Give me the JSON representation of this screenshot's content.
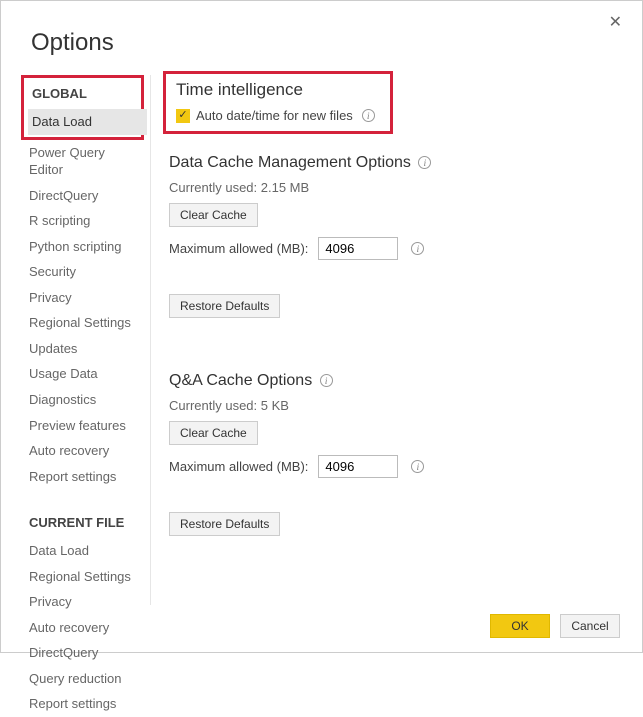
{
  "dialog": {
    "title": "Options",
    "close_glyph": "✕"
  },
  "sidebar": {
    "global_header": "GLOBAL",
    "global_items": [
      "Data Load",
      "Power Query Editor",
      "DirectQuery",
      "R scripting",
      "Python scripting",
      "Security",
      "Privacy",
      "Regional Settings",
      "Updates",
      "Usage Data",
      "Diagnostics",
      "Preview features",
      "Auto recovery",
      "Report settings"
    ],
    "current_file_header": "CURRENT FILE",
    "current_file_items": [
      "Data Load",
      "Regional Settings",
      "Privacy",
      "Auto recovery",
      "DirectQuery",
      "Query reduction",
      "Report settings"
    ],
    "selected_global_index": 0
  },
  "content": {
    "time_intelligence": {
      "title": "Time intelligence",
      "checkbox_label": "Auto date/time for new files",
      "checked": true
    },
    "data_cache": {
      "title": "Data Cache Management Options",
      "currently_used_label": "Currently used: 2.15 MB",
      "clear_label": "Clear Cache",
      "max_label": "Maximum allowed (MB):",
      "max_value": "4096",
      "restore_label": "Restore Defaults"
    },
    "qa_cache": {
      "title": "Q&A Cache Options",
      "currently_used_label": "Currently used: 5 KB",
      "clear_label": "Clear Cache",
      "max_label": "Maximum allowed (MB):",
      "max_value": "4096",
      "restore_label": "Restore Defaults"
    }
  },
  "footer": {
    "ok": "OK",
    "cancel": "Cancel"
  }
}
